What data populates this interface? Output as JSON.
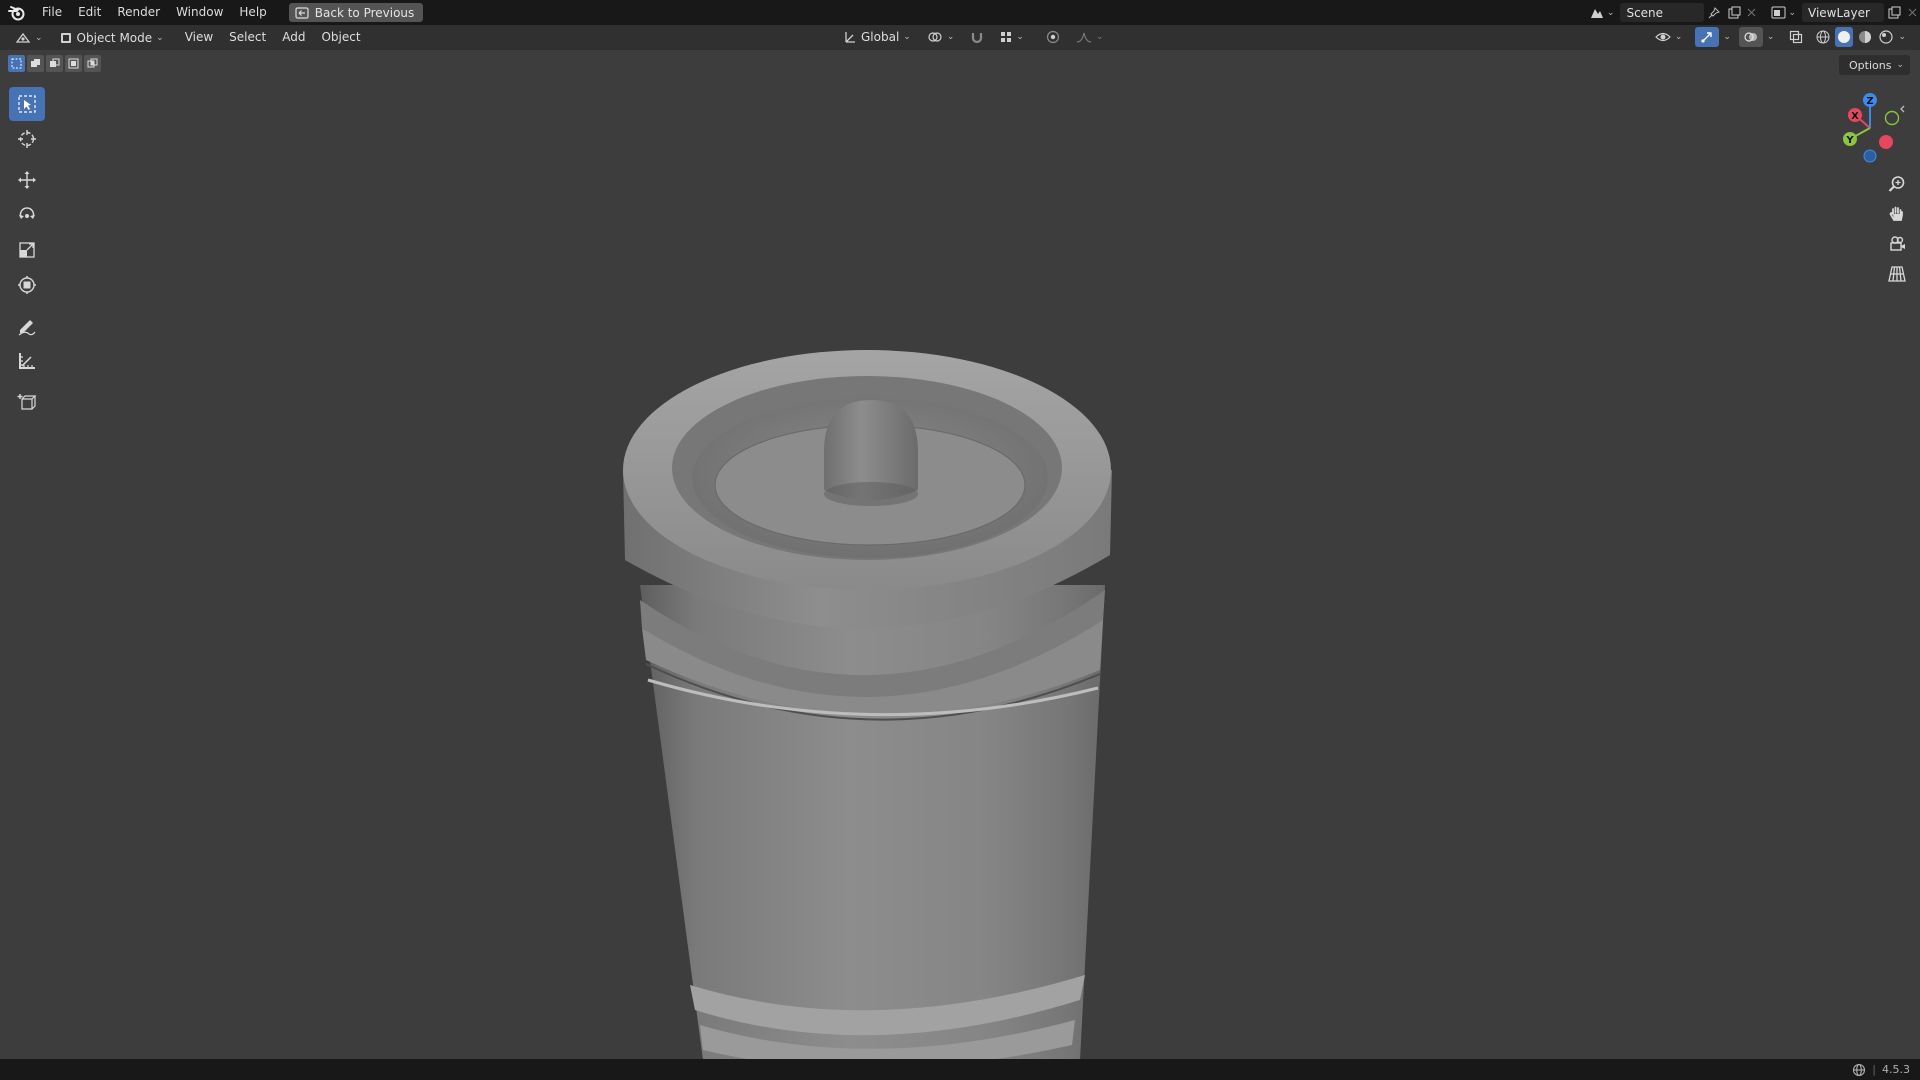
{
  "app": {
    "name": "Blender",
    "version": "4.5.3"
  },
  "topbar": {
    "menus": [
      "File",
      "Edit",
      "Render",
      "Window",
      "Help"
    ],
    "back_button": "Back to Previous",
    "scene": "Scene",
    "view_layer": "ViewLayer"
  },
  "header": {
    "mode": "Object Mode",
    "menus": [
      "View",
      "Select",
      "Add",
      "Object"
    ],
    "transform_orientation": "Global"
  },
  "viewport": {
    "options_label": "Options",
    "gizmo_axes": [
      "X",
      "Y",
      "Z"
    ]
  },
  "toolbar": {
    "tools": [
      "select-box",
      "cursor",
      "move",
      "rotate",
      "scale",
      "transform",
      "annotate",
      "measure",
      "add-cube"
    ],
    "active_tool": "select-box"
  },
  "colors": {
    "accent": "#4772b3",
    "viewport_bg": "#3d3d3d",
    "topbar_bg": "#181818",
    "header_bg": "#303030",
    "axis_x": "#e5475e",
    "axis_y": "#8bc43d",
    "axis_z": "#3b8bef"
  }
}
